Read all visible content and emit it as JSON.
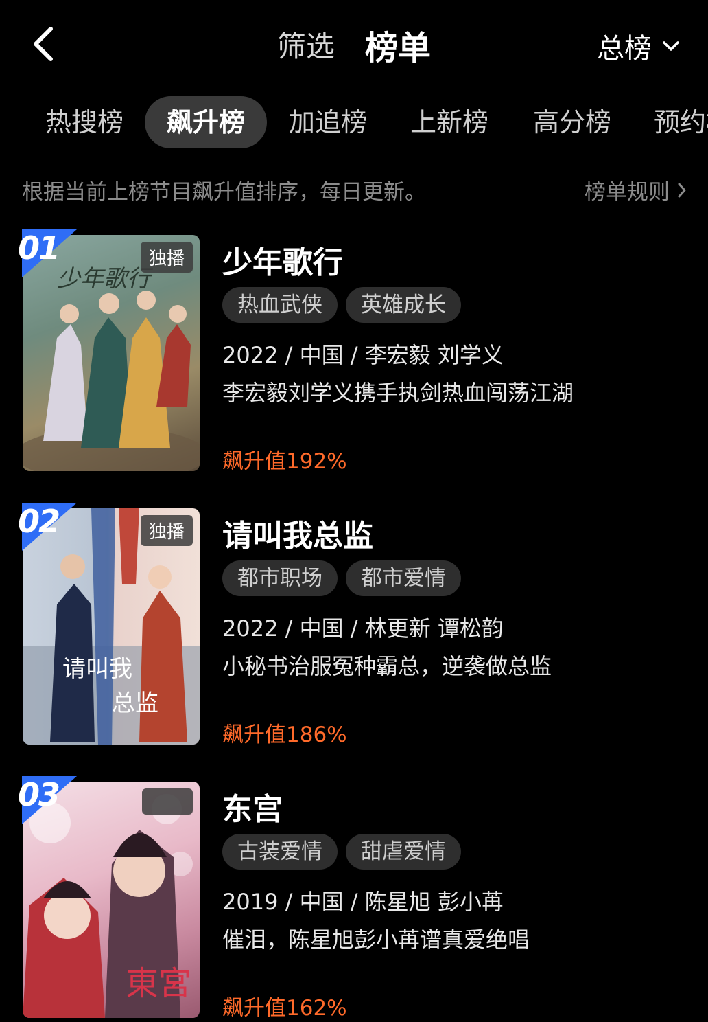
{
  "header": {
    "filter_label": "筛选",
    "rank_label": "榜单",
    "rank_select": "总榜"
  },
  "tabs": [
    {
      "label": "热搜榜"
    },
    {
      "label": "飙升榜",
      "active": true
    },
    {
      "label": "加追榜"
    },
    {
      "label": "上新榜"
    },
    {
      "label": "高分榜"
    },
    {
      "label": "预约榜"
    }
  ],
  "description": {
    "text": "根据当前上榜节目飙升值排序，每日更新。",
    "rules_label": "榜单规则"
  },
  "items": [
    {
      "rank": "01",
      "badge": "独播",
      "title": "少年歌行",
      "tags": [
        "热血武侠",
        "英雄成长"
      ],
      "meta": "2022 / 中国 / 李宏毅 刘学义",
      "blurb": "李宏毅刘学义携手执剑热血闯荡江湖",
      "rise": "飙升值192%",
      "poster_text": "少年歌行"
    },
    {
      "rank": "02",
      "badge": "独播",
      "title": "请叫我总监",
      "tags": [
        "都市职场",
        "都市爱情"
      ],
      "meta": "2022 / 中国 / 林更新 谭松韵",
      "blurb": "小秘书治服冤种霸总，逆袭做总监",
      "rise": "飙升值186%",
      "poster_text": "请叫我总监"
    },
    {
      "rank": "03",
      "badge": "",
      "title": "东宫",
      "tags": [
        "古装爱情",
        "甜虐爱情"
      ],
      "meta": "2019 / 中国 / 陈星旭 彭小苒",
      "blurb": "催泪，陈星旭彭小苒谱真爱绝唱",
      "rise": "飙升值162%",
      "poster_text": "東宮"
    }
  ],
  "colors": {
    "background": "#000000",
    "accent_orange": "#ff6a2a",
    "rank_badge_blue": "#2f6df6",
    "tag_bg": "#2e2e2e"
  }
}
